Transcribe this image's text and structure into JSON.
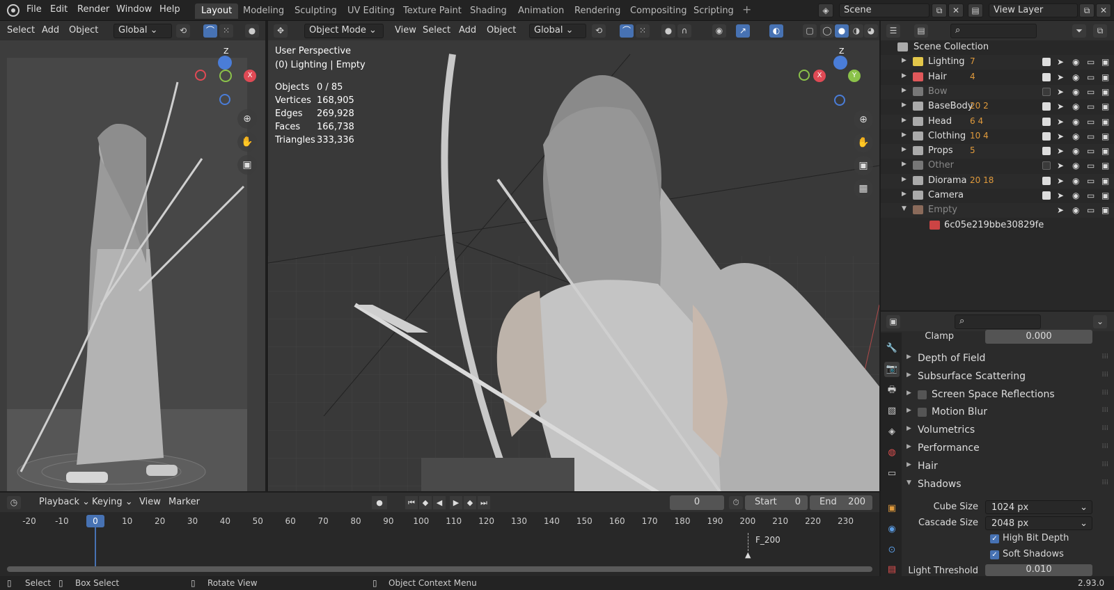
{
  "menu": {
    "file": "File",
    "edit": "Edit",
    "render": "Render",
    "window": "Window",
    "help": "Help"
  },
  "workspaces": [
    "Layout",
    "Modeling",
    "Sculpting",
    "UV Editing",
    "Texture Paint",
    "Shading",
    "Animation",
    "Rendering",
    "Compositing",
    "Scripting"
  ],
  "active_workspace": "Layout",
  "scene": {
    "name": "Scene",
    "view_layer": "View Layer"
  },
  "left_view": {
    "select": "Select",
    "add": "Add",
    "object": "Object",
    "orientation": "Global"
  },
  "main_view": {
    "mode": "Object Mode",
    "view": "View",
    "select": "Select",
    "add": "Add",
    "object": "Object",
    "orientation": "Global"
  },
  "overlay": {
    "perspective": "User Perspective",
    "context": "(0) Lighting | Empty"
  },
  "stats": [
    {
      "k": "Objects",
      "v": "0 / 85"
    },
    {
      "k": "Vertices",
      "v": "168,905"
    },
    {
      "k": "Edges",
      "v": "269,928"
    },
    {
      "k": "Faces",
      "v": "166,738"
    },
    {
      "k": "Triangles",
      "v": "333,336"
    }
  ],
  "gizmo": {
    "z": "Z",
    "x": "X",
    "y": "Y"
  },
  "outliner": {
    "root": "Scene Collection",
    "items": [
      {
        "name": "Lighting",
        "badge": "7",
        "checked": true,
        "dim": false,
        "color": "#e3c74a"
      },
      {
        "name": "Hair",
        "badge": "4",
        "checked": true,
        "dim": false,
        "color": "#e0585a"
      },
      {
        "name": "Bow",
        "badge": "",
        "checked": false,
        "dim": true,
        "color": "#777777"
      },
      {
        "name": "BaseBody",
        "badge": "20  2",
        "checked": true,
        "dim": false,
        "color": "#aaaaaa"
      },
      {
        "name": "Head",
        "badge": "6  4",
        "checked": true,
        "dim": false,
        "color": "#aaaaaa"
      },
      {
        "name": "Clothing",
        "badge": "10  4",
        "checked": true,
        "dim": false,
        "color": "#aaaaaa"
      },
      {
        "name": "Props",
        "badge": "5",
        "checked": true,
        "dim": false,
        "color": "#aaaaaa"
      },
      {
        "name": "Other",
        "badge": "",
        "checked": false,
        "dim": true,
        "color": "#777777"
      },
      {
        "name": "Diorama",
        "badge": "20  18",
        "checked": true,
        "dim": false,
        "color": "#aaaaaa"
      },
      {
        "name": "Camera",
        "badge": "",
        "checked": true,
        "dim": false,
        "color": "#aaaaaa"
      },
      {
        "name": "Empty",
        "badge": "",
        "checked": false,
        "dim": true,
        "color": "#8a6a5a"
      }
    ],
    "image": "6c05e219bbe30829fe"
  },
  "properties": {
    "clamp_label": "Clamp",
    "clamp_value": "0.000",
    "panels": [
      {
        "label": "Depth of Field",
        "check": false
      },
      {
        "label": "Subsurface Scattering",
        "check": false
      },
      {
        "label": "Screen Space Reflections",
        "check": true
      },
      {
        "label": "Motion Blur",
        "check": true
      },
      {
        "label": "Volumetrics",
        "check": false
      },
      {
        "label": "Performance",
        "check": false
      },
      {
        "label": "Hair",
        "check": false
      },
      {
        "label": "Shadows",
        "check": false
      }
    ],
    "cube_size_label": "Cube Size",
    "cube_size": "1024 px",
    "cascade_size_label": "Cascade Size",
    "cascade_size": "2048 px",
    "high_bit_depth": "High Bit Depth",
    "soft_shadows": "Soft Shadows",
    "light_threshold_label": "Light Threshold",
    "light_threshold": "0.010"
  },
  "timeline": {
    "playback": "Playback",
    "keying": "Keying",
    "view": "View",
    "marker": "Marker",
    "current_frame": "0",
    "start_label": "Start",
    "start": "0",
    "end_label": "End",
    "end": "200",
    "ticks": [
      "-20",
      "-10",
      "0",
      "10",
      "20",
      "30",
      "40",
      "50",
      "60",
      "70",
      "80",
      "90",
      "100",
      "110",
      "120",
      "130",
      "140",
      "150",
      "160",
      "170",
      "180",
      "190",
      "200",
      "210",
      "220",
      "230"
    ],
    "marker_label": "F_200"
  },
  "status": {
    "select": "Select",
    "box_select": "Box Select",
    "rotate": "Rotate View",
    "context": "Object Context Menu",
    "version": "2.93.0"
  }
}
